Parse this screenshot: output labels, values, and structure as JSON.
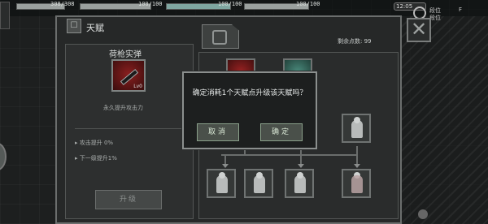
{
  "hud": {
    "stat1": "308/308",
    "stat2": "100/100",
    "stat3": "100/100",
    "stat4": "100/100",
    "stat1_fill": 1.0,
    "stat2_fill": 1.0,
    "stat3_fill": 1.0,
    "stat4_fill": 1.0,
    "time": "12:05",
    "tag_top": "段位",
    "tag_right": "F",
    "tag_bottom": "段位"
  },
  "window": {
    "title": "天赋",
    "title_icon": "talent-icon",
    "remaining_points": "剩余点数: 99",
    "close_icon": "close-icon"
  },
  "skill": {
    "name": "荷枪实弹",
    "icon": "bullet-icon",
    "level_label": "Lv0",
    "description": "永久提升攻击力",
    "stats": [
      "攻击提升 0%",
      "下一级提升1%"
    ],
    "upgrade_label": "升级"
  },
  "tree": {
    "nodes": [
      {
        "icon": "bullet-icon",
        "style": "red"
      },
      {
        "icon": "armor-icon",
        "style": "teal"
      },
      {
        "icon": "fighter-icon",
        "style": "dark"
      },
      {
        "icon": "fighter-icon",
        "style": "dark"
      },
      {
        "icon": "fighter-icon",
        "style": "dark"
      },
      {
        "icon": "fighter-icon",
        "style": "dark"
      },
      {
        "icon": "fighter-icon",
        "style": "dark"
      },
      {
        "icon": "demon-icon",
        "style": "dark"
      }
    ]
  },
  "dialog": {
    "message": "确定消耗1个天赋点升级该天赋吗？",
    "cancel_label": "取消",
    "confirm_label": "确定"
  }
}
